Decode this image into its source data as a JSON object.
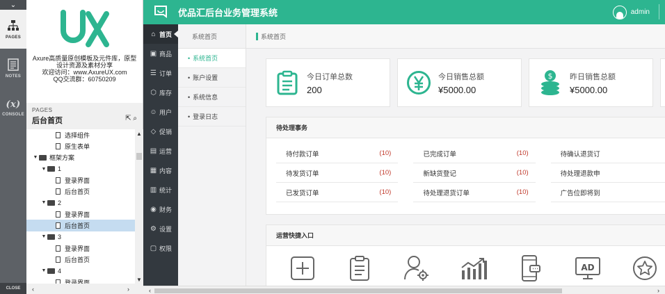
{
  "axure": {
    "rail": {
      "collapse": "⌄",
      "pages": "PAGES",
      "notes": "NOTES",
      "console": "CONSOLE",
      "close": "CLOSE"
    },
    "logo_text": "UX",
    "info_lines": [
      "Axure高质量原创模板及元件库，原型",
      "设计资源及素材分享",
      "欢迎访问：www.AxureUX.com",
      "QQ交流群：60750209"
    ],
    "pages_label": "PAGES",
    "current_page": "后台首页",
    "tree": [
      {
        "label": "选择组件",
        "type": "page",
        "indent": 2
      },
      {
        "label": "原生表单",
        "type": "page",
        "indent": 2
      },
      {
        "label": "框架方案",
        "type": "folder",
        "indent": 0
      },
      {
        "label": "1",
        "type": "folder",
        "indent": 1
      },
      {
        "label": "登录界面",
        "type": "page",
        "indent": 2
      },
      {
        "label": "后台首页",
        "type": "page",
        "indent": 2
      },
      {
        "label": "2",
        "type": "folder",
        "indent": 1
      },
      {
        "label": "登录界面",
        "type": "page",
        "indent": 2
      },
      {
        "label": "后台首页",
        "type": "page",
        "indent": 2,
        "selected": true
      },
      {
        "label": "3",
        "type": "folder",
        "indent": 1
      },
      {
        "label": "登录界面",
        "type": "page",
        "indent": 2
      },
      {
        "label": "后台首页",
        "type": "page",
        "indent": 2
      },
      {
        "label": "4",
        "type": "folder",
        "indent": 1
      },
      {
        "label": "登录界面",
        "type": "page",
        "indent": 2
      }
    ]
  },
  "app": {
    "title": "优品汇后台业务管理系统",
    "user": "admin",
    "accent": "#2db590",
    "nav": [
      {
        "label": "首页",
        "icon": "⌂",
        "active": true
      },
      {
        "label": "商品",
        "icon": "▣"
      },
      {
        "label": "订单",
        "icon": "☰"
      },
      {
        "label": "库存",
        "icon": "⬡"
      },
      {
        "label": "用户",
        "icon": "☺"
      },
      {
        "label": "促销",
        "icon": "◇"
      },
      {
        "label": "运营",
        "icon": "▤"
      },
      {
        "label": "内容",
        "icon": "▦"
      },
      {
        "label": "统计",
        "icon": "▥"
      },
      {
        "label": "财务",
        "icon": "◉"
      },
      {
        "label": "设置",
        "icon": "⚙"
      },
      {
        "label": "权限",
        "icon": "▢"
      }
    ],
    "subnav_header": "系统首页",
    "subnav": [
      {
        "label": "系统首页",
        "active": true
      },
      {
        "label": "账户设置"
      },
      {
        "label": "系统信息"
      },
      {
        "label": "登录日志"
      }
    ],
    "breadcrumb": "系统首页",
    "stats": [
      {
        "label": "今日订单总数",
        "value": "200",
        "icon": "clipboard-icon"
      },
      {
        "label": "今日销售总额",
        "value": "¥5000.00",
        "icon": "yen-icon"
      },
      {
        "label": "昨日销售总额",
        "value": "¥5000.00",
        "icon": "coins-icon"
      }
    ],
    "pending_title": "待处理事务",
    "pending": [
      [
        {
          "label": "待付款订单",
          "count": "(10)"
        },
        {
          "label": "待发货订单",
          "count": "(10)"
        },
        {
          "label": "已发货订单",
          "count": "(10)"
        }
      ],
      [
        {
          "label": "已完成订单",
          "count": "(10)"
        },
        {
          "label": "新缺货登记",
          "count": "(10)"
        },
        {
          "label": "待处理退货订单",
          "count": "(10)"
        }
      ],
      [
        {
          "label": "待确认退货订",
          "count": ""
        },
        {
          "label": "待处理退款申",
          "count": ""
        },
        {
          "label": "广告位即将到",
          "count": ""
        }
      ]
    ],
    "quick_title": "运营快捷入口",
    "quick_icons": [
      "add-icon",
      "clipboard-icon",
      "user-settings-icon",
      "chart-growth-icon",
      "mobile-chat-icon",
      "ad-icon",
      "star-icon"
    ],
    "ad_label": "AD"
  }
}
